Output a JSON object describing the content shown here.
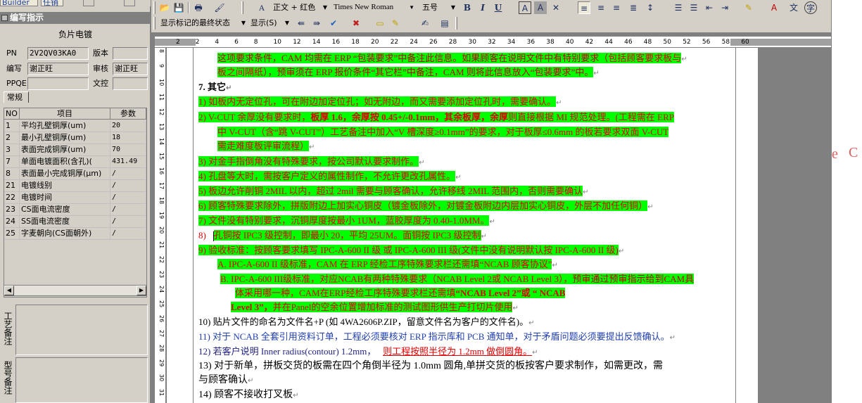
{
  "top_tabs": [
    "Builder",
    "任销"
  ],
  "panel_title": "编写指示",
  "subtitle": "负片电镀",
  "form": {
    "pn_label": "PN",
    "pn_value": "2V2QV03KA0",
    "version_label": "版本",
    "version_value": "",
    "writer_label": "编写",
    "writer_value": "谢正旺",
    "reviewer_label": "审核",
    "reviewer_value": "谢正旺",
    "ppqe_label": "PPQE",
    "ppqe_value": "",
    "doc_control_label": "文控",
    "doc_control_value": ""
  },
  "tab_label": "常规",
  "grid": {
    "headers": [
      "NO",
      "项目",
      "参数"
    ],
    "rows": [
      {
        "no": "1",
        "item": "平均孔壁铜厚(um)",
        "value": "20"
      },
      {
        "no": "2",
        "item": "最小孔壁铜厚(um)",
        "value": "18"
      },
      {
        "no": "3",
        "item": "表面完成铜厚(um)",
        "value": "70"
      },
      {
        "no": "7",
        "item": "单面电镀面积(含孔)(",
        "value": "431.49"
      },
      {
        "no": "8",
        "item": "表面最小完成铜厚(μm)",
        "value": "/"
      },
      {
        "no": "21",
        "item": "电镀线别",
        "value": "/"
      },
      {
        "no": "22",
        "item": "电镀时间",
        "value": "/"
      },
      {
        "no": "23",
        "item": "CS面电流密度",
        "value": "/"
      },
      {
        "no": "24",
        "item": "SS面电流密度",
        "value": "/"
      },
      {
        "no": "25",
        "item": "字麦朝向(CS面朝外)",
        "value": "/"
      }
    ]
  },
  "notes": {
    "process_notes_label": "工艺备注",
    "model_notes_label": "型号备注"
  },
  "toolbar": {
    "style_combo": "正文 + 红色",
    "font_combo": "Times New Roman",
    "size_combo": "五号",
    "bold": "B",
    "italic": "I",
    "underline": "U",
    "markup_combo": "显示标记的最终状态",
    "show_combo": "显示(S)"
  },
  "ruler": {
    "numbers": [
      "2",
      "2",
      "4",
      "6",
      "8",
      "10",
      "12",
      "14",
      "16",
      "18",
      "20",
      "22",
      "24",
      "26",
      "28",
      "30",
      "32",
      "34",
      "36",
      "38",
      "40",
      "42",
      "44",
      "46",
      "48",
      "50",
      "52",
      "56",
      "58",
      "60"
    ]
  },
  "vruler": {
    "numbers": [
      "8",
      "9",
      "10",
      "11",
      "12",
      "13",
      "14",
      "15",
      "16",
      "17",
      "18",
      "19",
      "20",
      "21",
      "22",
      "23",
      "24",
      "25",
      "26",
      "27",
      "28",
      "29",
      "30",
      "31"
    ]
  },
  "document": {
    "l1_a": "这项要求条件，CAM 均需在 ERP “包装要求”中备注此信息。如果顾客在说明文件中有特别要求（",
    "l1_b": "包括顾客要求板与",
    "l2_a": "板之间隔纸",
    "l2_b": "），预审须在 ERP 报价条件“其它栏”中备注，CAM 则将此信息放入“包装要求”中。",
    "heading": "7.  其它",
    "l4": "1)   如板内无定位孔，可在附边加定位孔；如无附边，而又需要添加定位孔时，需要确认。",
    "l5_a": "2)   V-CUT 余厚没有要求时，",
    "l5_b": "板厚 1.6，余厚按 0.45+/-0.1mm，其余板厚，余厚",
    "l5_c": "则直接根据 MI 规范处理。(工程需在 ERP",
    "l6": "中 V-CUT（含“跳 V-CUT”）工艺备注中加入“V 槽深度≥0.1mm”的要求，对于板厚≤0.6mm 的板若要求双面 V-CUT",
    "l7": "需走难度板评审流程）",
    "l8": "3)   对金手指倒角没有特殊要求，按公司默认要求制作。",
    "l9": "4)   孔盘等大时，需按客户定义的属性制作，不允许更改孔属性。",
    "l10": "5)   板边允许削铜 2MIL 以内，超过 2mil 需要与顾客确认，允许移线 2MIL 范围内，否则需要确认",
    "l11": "6)   顾客特殊要求除外，拼版附边上加实心铜皮（镀金板除外，对镀金板附边内层加实心铜皮，外层不加任何铜）",
    "l12": "7)   文件没有特别要求，沉铜厚度按最小 1UM，蓝胶厚度为 0.40-1.0MM。",
    "l13_num": "8)",
    "l13": "孔铜按 IPC3 级控制，即最小 20，平均 25UM。面铜按 IPC3 级控制",
    "l14": "9)   验收标准：按顾客要求填写 IPC-A-600 II 级 或 IPC-A-600 III 级(文件中没有说明默认按 IPC-A-600 II 级)",
    "l15": "A.  IPC-A-600 II 级标准，CAM 在 ERP 经检工序特殊要求栏还需填“NCAB 顾客协议”",
    "l16_a": "B.  IPC-A-600 III级标准，对应NCAB有两种特殊要求（NCAB Level 2或 NCAB Level 3），",
    "l16_b": "预审通过预审指示给到CAM具",
    "l17_a": "体采用哪一种，CAM在ERP经检工序特殊要求栏还需填",
    "l17_b": "“NCAB Level 2”或 “ NCAB",
    "l18_a": "Level 3”，",
    "l18_b": "并在Panel的空余位置增加标准的测试图形供生产打切片使用",
    "l19": "10) 贴片文件的命名为文件名+P  (如 4WA2606P.ZIP，留意文件名为客户的文件名)。",
    "l20": "11) 对于 NCAB 全套引用资料订单，工程必须要核对 ERP 指示库和 PCB 通知单，对于矛盾问题必须要提出反馈确认。",
    "l21_a": "12) 若客户说明 Inner radius(contour) 1.2mm，",
    "l21_b": "则工程按照半径为 1.2mm 做倒圆角。",
    "l22": "13)  对于新单，拼板交货的板需在四个角倒半径为 1.0mm 圆角,单拼交货的板按客户要求制作，如需更改，需",
    "l23": "与顾客确认",
    "l24": "14) 顾客不接收打叉板"
  },
  "ghost": {
    "letter_e": "e",
    "letter_c": "C"
  },
  "colors": {
    "highlight": "#00ff00",
    "red": "#e00000",
    "toolbar": "#d4d0c8"
  }
}
